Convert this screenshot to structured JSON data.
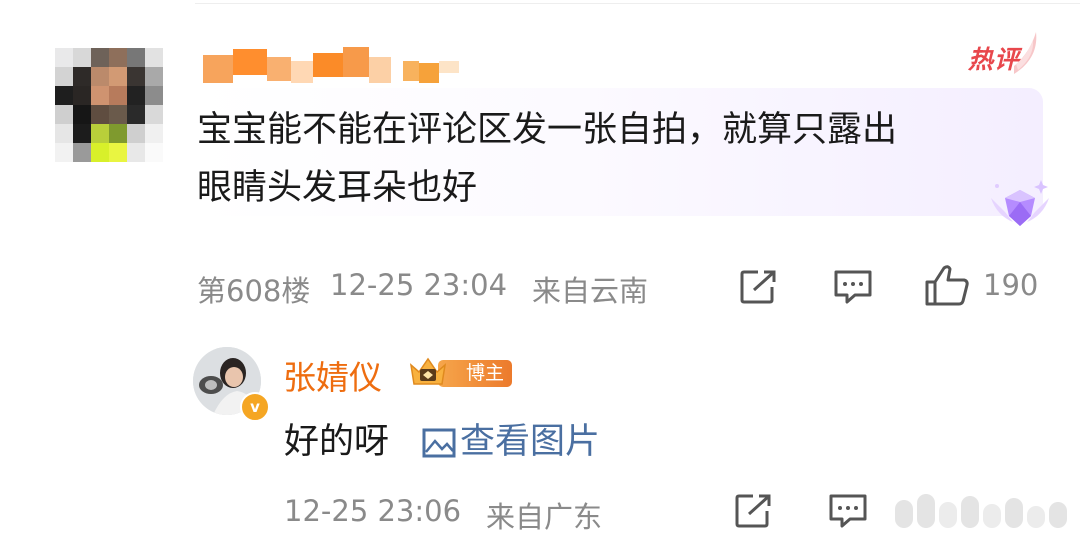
{
  "comment": {
    "badge": "热评",
    "text_line1": "宝宝能不能在评论区发一张自拍，就算只露出",
    "text_line2": "眼睛头发耳朵也好",
    "floor": "第608楼",
    "time": "12-25 23:04",
    "location": "来自云南",
    "like_count": "190"
  },
  "reply": {
    "author": "张婧仪",
    "badge_label": "博主",
    "text": "好的呀",
    "link_text": "查看图片",
    "time": "12-25 23:06",
    "location": "来自广东"
  },
  "colors": {
    "accent_orange": "#ee6d10",
    "link_blue": "#4a6fa1",
    "hot_red": "#e8474c",
    "meta_gray": "#8a8a8a"
  }
}
